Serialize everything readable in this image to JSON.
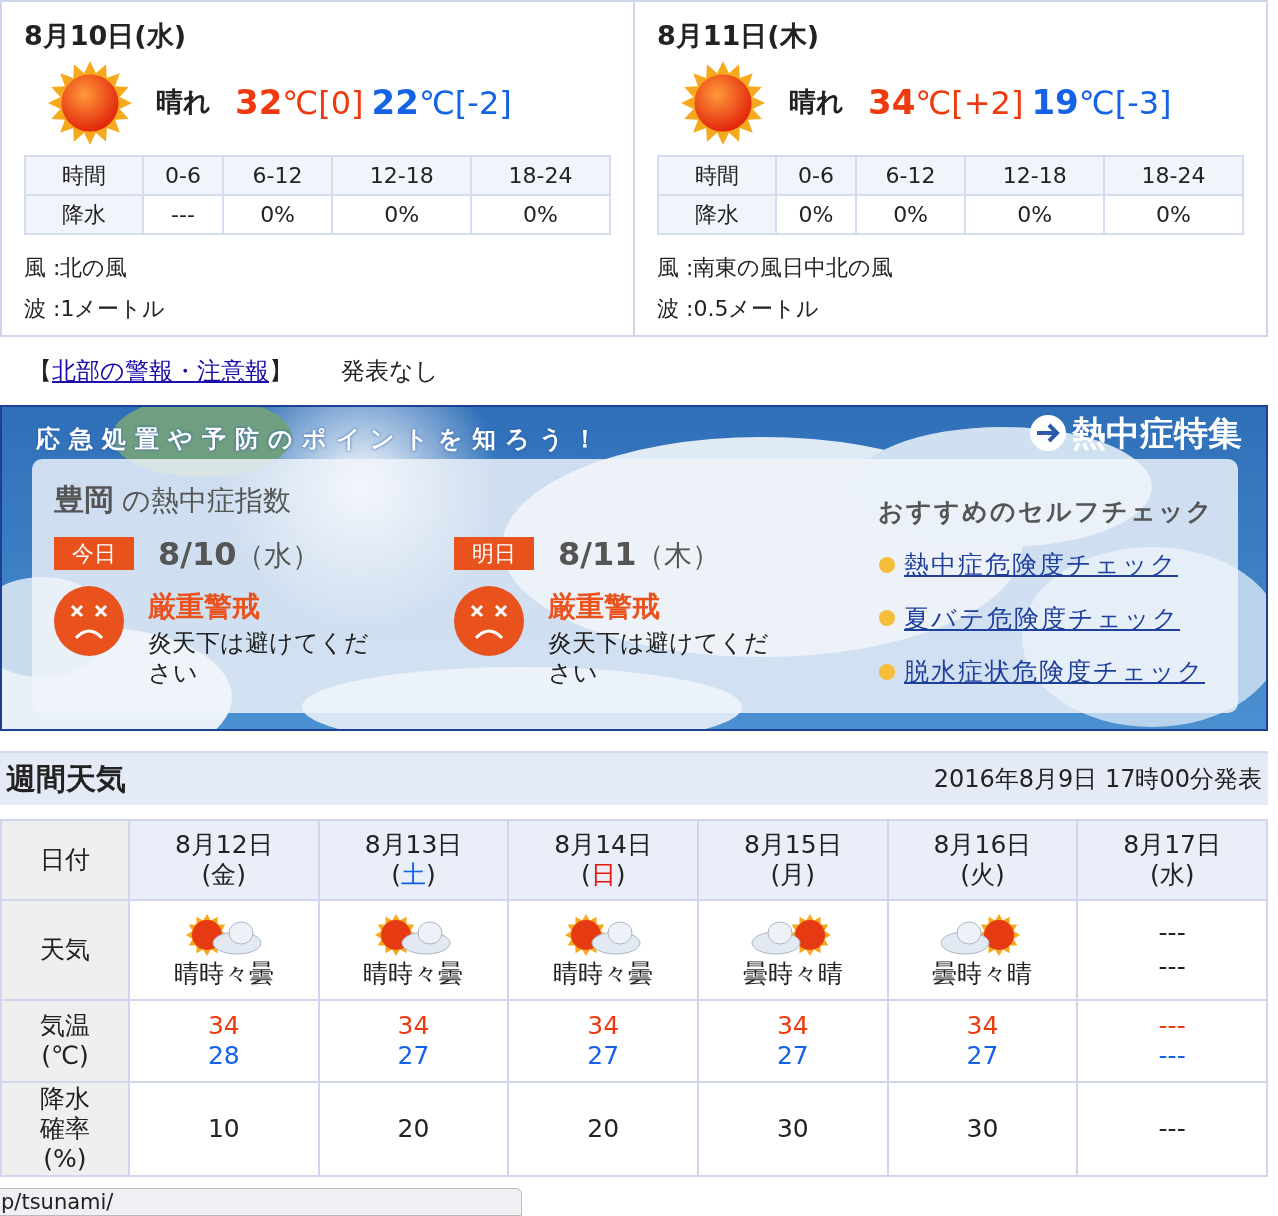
{
  "days": [
    {
      "date": "8月10日(水)",
      "kind": "sun",
      "weather": "晴れ",
      "high": "32",
      "high_unit": "℃[0]",
      "low": "22",
      "low_unit": "℃[-2]",
      "table_header": "時間",
      "periods": [
        "0-6",
        "6-12",
        "12-18",
        "18-24"
      ],
      "row_label": "降水",
      "precip": [
        "---",
        "0%",
        "0%",
        "0%"
      ],
      "wind": "風 :北の風",
      "wave": "波 :1メートル"
    },
    {
      "date": "8月11日(木)",
      "kind": "sun",
      "weather": "晴れ",
      "high": "34",
      "high_unit": "℃[+2]",
      "low": "19",
      "low_unit": "℃[-3]",
      "table_header": "時間",
      "periods": [
        "0-6",
        "6-12",
        "12-18",
        "18-24"
      ],
      "row_label": "降水",
      "precip": [
        "0%",
        "0%",
        "0%",
        "0%"
      ],
      "wind": "風 :南東の風日中北の風",
      "wave": "波 :0.5メートル"
    }
  ],
  "warnings": {
    "open": "【",
    "link": "北部の警報・注意報",
    "close": "】",
    "status": "発表なし"
  },
  "heatstroke": {
    "tagline": "応急処置や予防のポイントを知ろう！",
    "feature_link": "熱中症特集",
    "city": "豊岡",
    "title": "の熱中症指数",
    "days": [
      {
        "tag": "今日",
        "date": "8/10",
        "weekday": "（水）",
        "level": "厳重警戒",
        "advice": "炎天下は避けてください"
      },
      {
        "tag": "明日",
        "date": "8/11",
        "weekday": "（木）",
        "level": "厳重警戒",
        "advice": "炎天下は避けてください"
      }
    ],
    "self_check_title": "おすすめのセルフチェック",
    "self_checks": [
      "熱中症危険度チェック",
      "夏バテ危険度チェック",
      "脱水症状危険度チェック"
    ]
  },
  "weekly": {
    "title": "週間天気",
    "issued": "2016年8月9日 17時00分発表",
    "row_labels": [
      [
        "日付"
      ],
      [
        "天気"
      ],
      [
        "気温",
        "(℃)"
      ],
      [
        "降水",
        "確率",
        "(%)"
      ]
    ],
    "columns": [
      {
        "date": "8月12日",
        "weekday": {
          "open": "(",
          "day": "金",
          "close": ")",
          "kind": "weekday"
        },
        "kind": "sun_cloud",
        "weather": "晴時々曇",
        "high": "34",
        "low": "28",
        "precip": "10"
      },
      {
        "date": "8月13日",
        "weekday": {
          "open": "(",
          "day": "土",
          "close": ")",
          "kind": "saturday"
        },
        "kind": "sun_cloud",
        "weather": "晴時々曇",
        "high": "34",
        "low": "27",
        "precip": "20"
      },
      {
        "date": "8月14日",
        "weekday": {
          "open": "(",
          "day": "日",
          "close": ")",
          "kind": "sunday"
        },
        "kind": "sun_cloud",
        "weather": "晴時々曇",
        "high": "34",
        "low": "27",
        "precip": "20"
      },
      {
        "date": "8月15日",
        "weekday": {
          "open": "(",
          "day": "月",
          "close": ")",
          "kind": "weekday"
        },
        "kind": "cloud_sun",
        "weather": "曇時々晴",
        "high": "34",
        "low": "27",
        "precip": "30"
      },
      {
        "date": "8月16日",
        "weekday": {
          "open": "(",
          "day": "火",
          "close": ")",
          "kind": "weekday"
        },
        "kind": "cloud_sun",
        "weather": "曇時々晴",
        "high": "34",
        "low": "27",
        "precip": "30"
      },
      {
        "date": "8月17日",
        "weekday": {
          "open": "(",
          "day": "水",
          "close": ")",
          "kind": "weekday"
        },
        "kind": "none",
        "icon_text": "---",
        "weather": "---",
        "high": "---",
        "low": "---",
        "precip": "---"
      }
    ]
  },
  "status_bar": "p/tsunami/"
}
